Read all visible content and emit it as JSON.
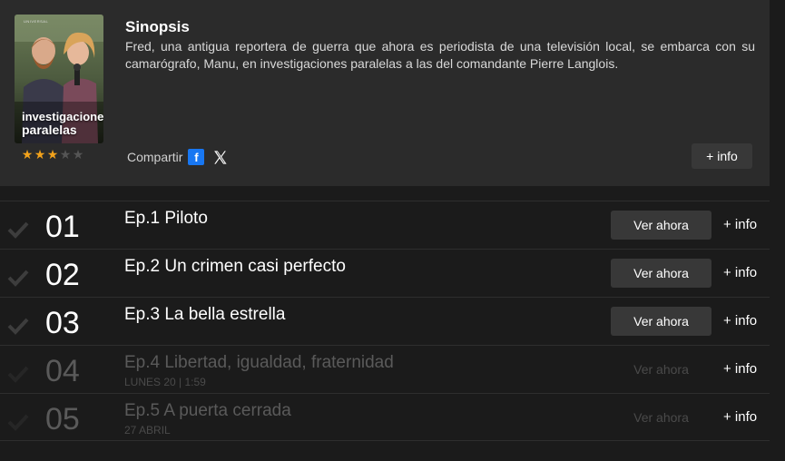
{
  "synopsis": {
    "title": "Sinopsis",
    "text": "Fred, una antigua reportera de guerra que ahora es periodista de una televisión local, se embarca con su camarógrafo, Manu, en investigaciones paralelas a las del comandante Pierre Langlois.",
    "poster_title_line1": "investigaciones",
    "poster_title_line2": "paralelas",
    "poster_brand": "UNIVERSAL",
    "rating": 3,
    "rating_max": 5,
    "share_label": "Compartir",
    "facebook_glyph": "f",
    "more_info_label": "+ info"
  },
  "colors": {
    "star_on": "#f2a21b",
    "star_off": "#555555",
    "facebook": "#1877f2"
  },
  "episodes": [
    {
      "num": "01",
      "title": "Ep.1 Piloto",
      "sub": "",
      "watch": "Ver ahora",
      "info": "+ info"
    },
    {
      "num": "02",
      "title": "Ep.2 Un crimen casi perfecto",
      "sub": "",
      "watch": "Ver ahora",
      "info": "+ info"
    },
    {
      "num": "03",
      "title": "Ep.3 La bella estrella",
      "sub": "",
      "watch": "Ver ahora",
      "info": "+ info"
    },
    {
      "num": "04",
      "title": "Ep.4 Libertad, igualdad, fraternidad",
      "sub": "LUNES 20 | 1:59",
      "watch": "Ver ahora",
      "info": "+ info"
    },
    {
      "num": "05",
      "title": "Ep.5 A puerta cerrada",
      "sub": "27 ABRIL",
      "watch": "Ver ahora",
      "info": "+ info"
    }
  ]
}
